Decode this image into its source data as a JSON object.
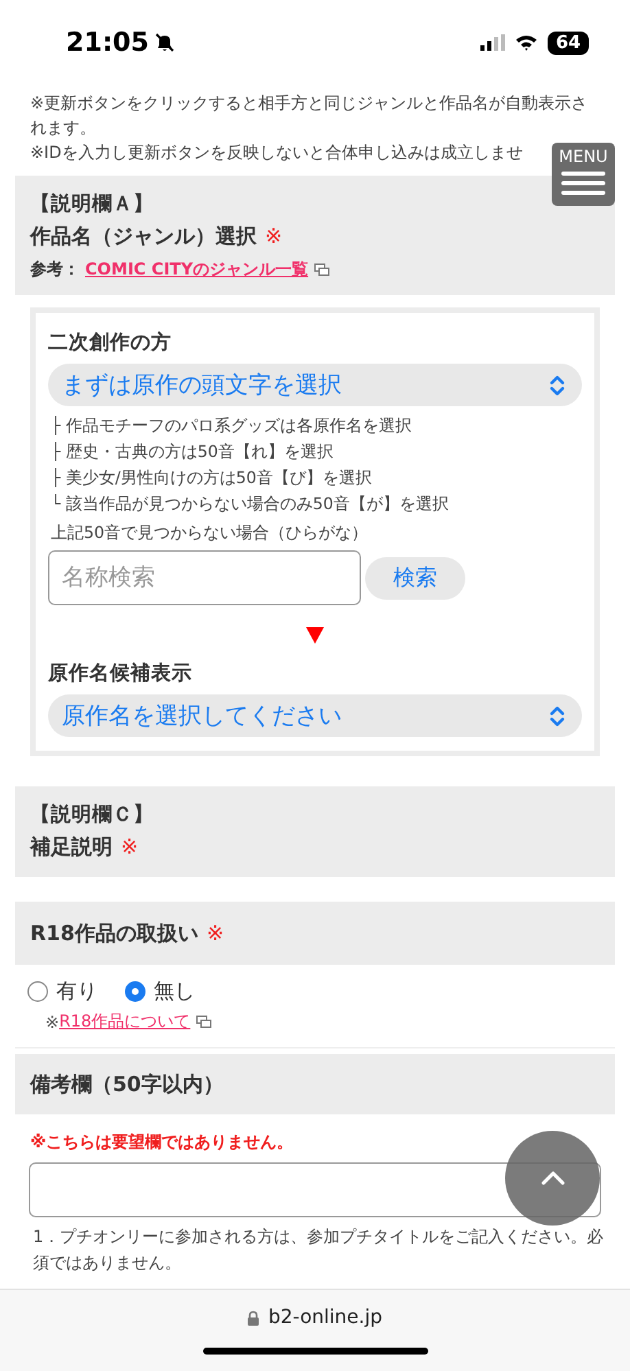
{
  "status_bar": {
    "time": "21:05",
    "battery": "64"
  },
  "notices": [
    "※更新ボタンをクリックすると相手方と同じジャンルと作品名が自動表示されます。",
    "※IDを入力し更新ボタンを反映しないと合体申し込みは成立しませ"
  ],
  "menu_button": {
    "label": "MENU"
  },
  "section_a": {
    "heading": "【説明欄Ａ】",
    "title": "作品名（ジャンル）選択",
    "required_mark": "※",
    "reference_label": "参考：",
    "reference_link": "COMIC CITYのジャンル一覧"
  },
  "genre_box": {
    "heading": "二次創作の方",
    "initial_select": "まずは原作の頭文字を選択",
    "hints": [
      "├ 作品モチーフのパロ系グッズは各原作名を選択",
      "├ 歴史・古典の方は50音【れ】を選択",
      "├ 美少女/男性向けの方は50音【び】を選択",
      "└ 該当作品が見つからない場合のみ50音【が】を選択"
    ],
    "search_label": "上記50音で見つからない場合（ひらがな）",
    "search": {
      "placeholder": "名称検索",
      "button": "検索"
    },
    "candidates_heading": "原作名候補表示",
    "candidate_select": "原作名を選択してください"
  },
  "section_c": {
    "heading": "【説明欄Ｃ】",
    "title": "補足説明",
    "required_mark": "※"
  },
  "r18": {
    "title": "R18作品の取扱い",
    "required_mark": "※",
    "options": [
      {
        "label": "有り",
        "selected": false
      },
      {
        "label": "無し",
        "selected": true
      }
    ],
    "note_prefix": "※",
    "link": "R18作品について"
  },
  "remarks": {
    "title": "備考欄（50字以内）",
    "warning": "※こちらは要望欄ではありません。",
    "note": "1．プチオンリーに参加される方は、参加プチタイトルをご記入ください。必須ではありません。"
  },
  "browser": {
    "url": "b2-online.jp"
  }
}
